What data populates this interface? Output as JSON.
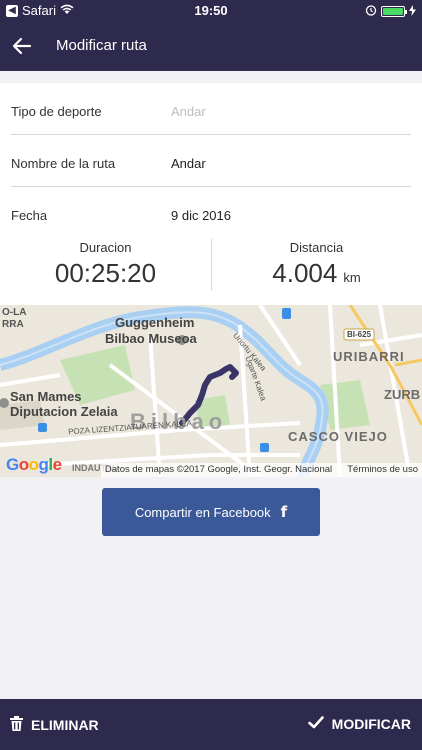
{
  "status_bar": {
    "back_badge": "◀",
    "carrier": "Safari",
    "time": "19:50",
    "icons": [
      "wifi-icon",
      "alarm-icon",
      "battery-icon",
      "charging-icon"
    ],
    "battery_level": 1.0
  },
  "nav": {
    "back_icon": "arrow-left-icon",
    "title": "Modificar ruta"
  },
  "form": {
    "sport_label": "Tipo de deporte",
    "sport_value": "Andar",
    "route_name_label": "Nombre de la ruta",
    "route_name_value": "Andar",
    "date_label": "Fecha",
    "date_value": "9 dic 2016"
  },
  "stats": {
    "duration_label": "Duracion",
    "duration_value": "00:25:20",
    "distance_label": "Distancia",
    "distance_value": "4.004",
    "distance_unit": "km"
  },
  "map": {
    "labels": {
      "guggenheim_1": "Guggenheim",
      "guggenheim_2": "Bilbao Museoa",
      "san_mames_1": "San Mames",
      "san_mames_2": "Diputacion Zelaia",
      "bilbao": "Bilbao",
      "uribarri": "URIBARRI",
      "casco_viejo": "CASCO VIEJO",
      "zurb": "ZURB",
      "ola": "O-LA",
      "ra": "RRA",
      "bi625": "BI-625",
      "uriortu": "Uriortu Kalea",
      "ugarte": "Ugarte Kalea",
      "pozas": "POZA LIZENTZIATUAREN KALEA",
      "indautxu": "INDAUTXU"
    },
    "logo": "Google",
    "attribution": "Datos de mapas ©2017 Google, Inst. Geogr. Nacional",
    "terms": "Términos de uso",
    "route_color": "#3a3566"
  },
  "share": {
    "label": "Compartir en Facebook",
    "icon": "facebook-icon",
    "color": "#3b5998"
  },
  "bottom_bar": {
    "delete_label": "ELIMINAR",
    "delete_icon": "trash-icon",
    "modify_label": "MODIFICAR",
    "modify_icon": "checkmark-icon"
  },
  "colors": {
    "primary": "#2e2a4d",
    "background": "#f2f2f4"
  }
}
